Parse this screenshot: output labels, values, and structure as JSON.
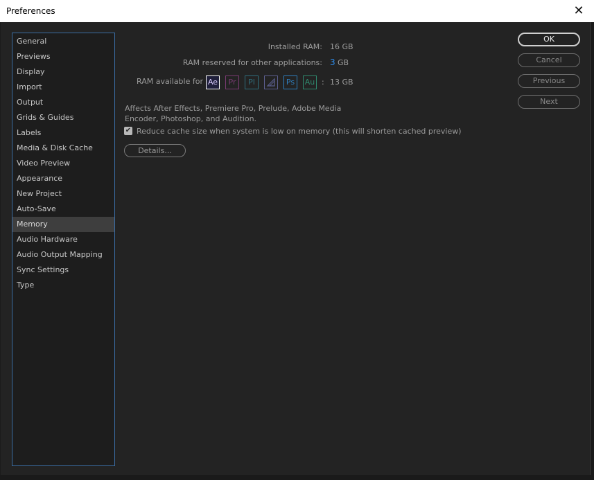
{
  "window": {
    "title": "Preferences"
  },
  "sidebar": {
    "items": [
      {
        "label": "General"
      },
      {
        "label": "Previews"
      },
      {
        "label": "Display"
      },
      {
        "label": "Import"
      },
      {
        "label": "Output"
      },
      {
        "label": "Grids & Guides"
      },
      {
        "label": "Labels"
      },
      {
        "label": "Media & Disk Cache"
      },
      {
        "label": "Video Preview"
      },
      {
        "label": "Appearance"
      },
      {
        "label": "New Project"
      },
      {
        "label": "Auto-Save"
      },
      {
        "label": "Memory"
      },
      {
        "label": "Audio Hardware"
      },
      {
        "label": "Audio Output Mapping"
      },
      {
        "label": "Sync Settings"
      },
      {
        "label": "Type"
      }
    ],
    "active": "Memory"
  },
  "memory": {
    "installed_ram_label": "Installed RAM:",
    "installed_ram_value": "16 GB",
    "reserved_label": "RAM reserved for other applications:",
    "reserved_value": "3",
    "reserved_unit": "GB",
    "available_label": "RAM available for",
    "available_sep": ":",
    "available_value": "13 GB",
    "apps": [
      {
        "abbr": "Ae",
        "color": "#9999ff",
        "icon": "after-effects-icon"
      },
      {
        "abbr": "Pr",
        "color": "#7a3b73",
        "icon": "premiere-pro-icon"
      },
      {
        "abbr": "Pl",
        "color": "#2f6f7f",
        "icon": "prelude-icon"
      },
      {
        "abbr": "",
        "color": "#5c5f8f",
        "icon": "media-encoder-icon"
      },
      {
        "abbr": "Ps",
        "color": "#2f7fbf",
        "icon": "photoshop-icon"
      },
      {
        "abbr": "Au",
        "color": "#2f8a6f",
        "icon": "audition-icon"
      }
    ],
    "description": "Affects After Effects, Premiere Pro, Prelude, Adobe Media Encoder, Photoshop, and Audition.",
    "reduce_cache_label": "Reduce cache size when system is low on memory (this will shorten cached preview)",
    "reduce_cache_checked": true,
    "details_label": "Details..."
  },
  "buttons": {
    "ok": "OK",
    "cancel": "Cancel",
    "previous": "Previous",
    "next": "Next"
  }
}
